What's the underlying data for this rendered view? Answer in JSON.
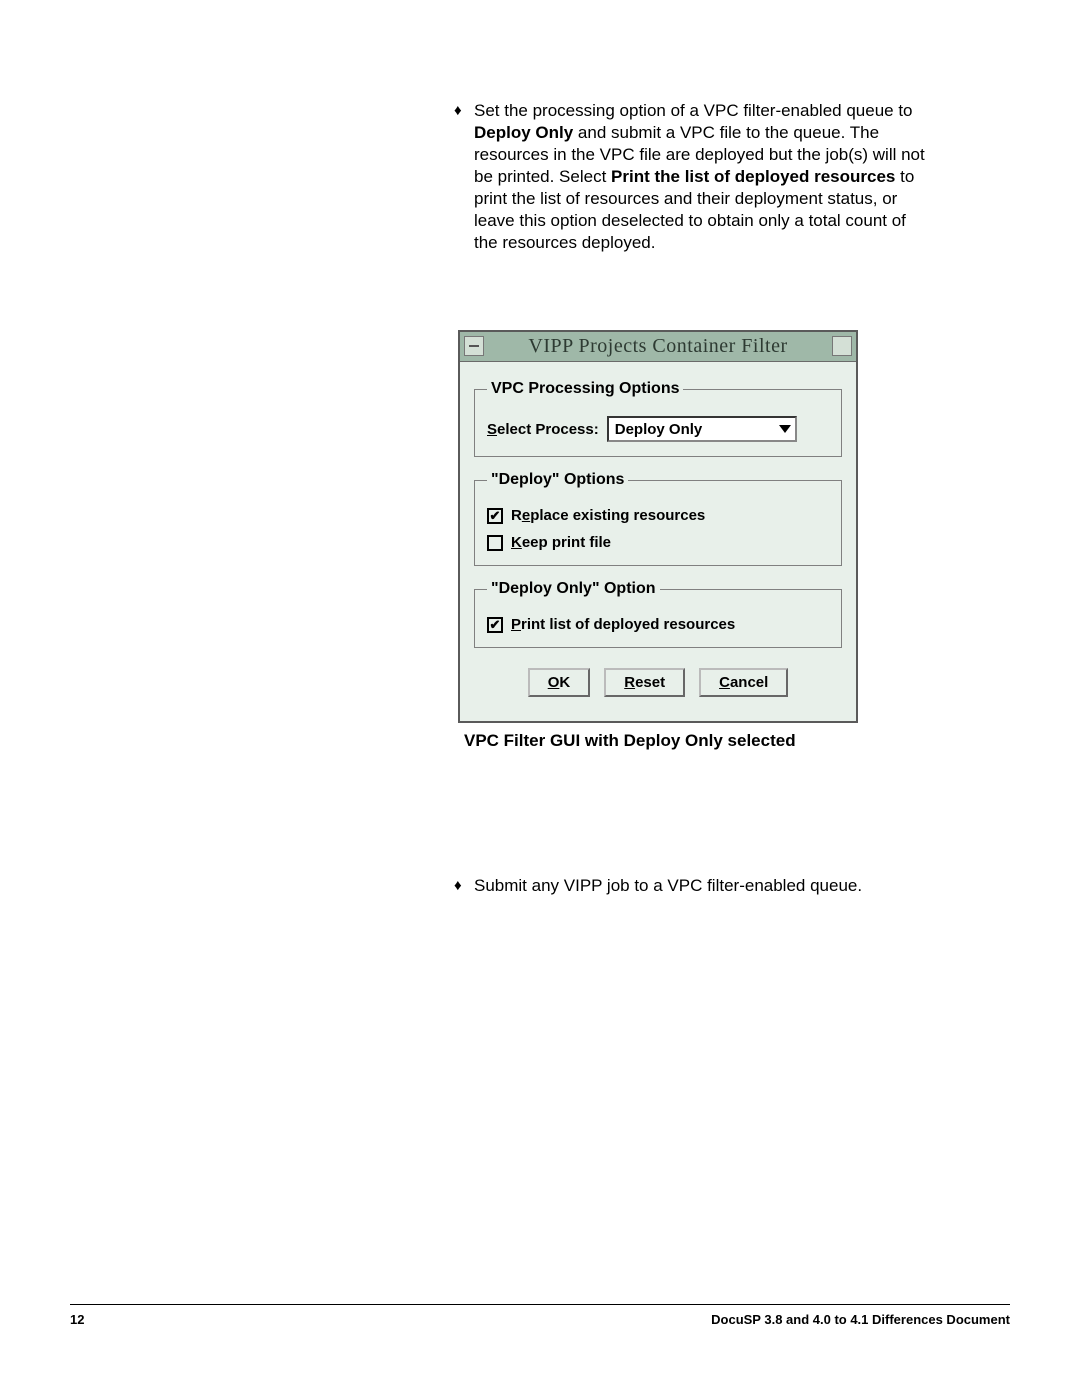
{
  "bullet1": {
    "pre": "Set the processing option of a VPC filter-enabled queue to ",
    "bold1": "Deploy Only",
    "mid1": " and submit a VPC file to the queue. The resources in the VPC file are deployed but the job(s) will not be printed. Select ",
    "bold2": "Print the list of deployed resources",
    "post": " to print the list of resources and their deployment status, or leave this option deselected to obtain only a total count of the resources deployed."
  },
  "dialog": {
    "title": "VIPP Projects Container Filter",
    "group1_legend": "VPC Processing Options",
    "select_label": "Select Process:",
    "select_value": "Deploy Only",
    "group2_legend": "\"Deploy\" Options",
    "check_replace": "Replace existing resources",
    "check_replace_checked": true,
    "check_keep": "Keep print file",
    "check_keep_checked": false,
    "group3_legend": "\"Deploy Only\" Option",
    "check_printlist": "Print list of deployed resources",
    "check_printlist_checked": true,
    "btn_ok": "OK",
    "btn_reset": "Reset",
    "btn_cancel": "Cancel"
  },
  "caption": "VPC Filter GUI with Deploy Only selected",
  "bullet2": "Submit any VIPP job to a VPC filter-enabled queue.",
  "footer": {
    "page": "12",
    "doc": "DocuSP 3.8 and 4.0 to 4.1 Differences Document"
  }
}
